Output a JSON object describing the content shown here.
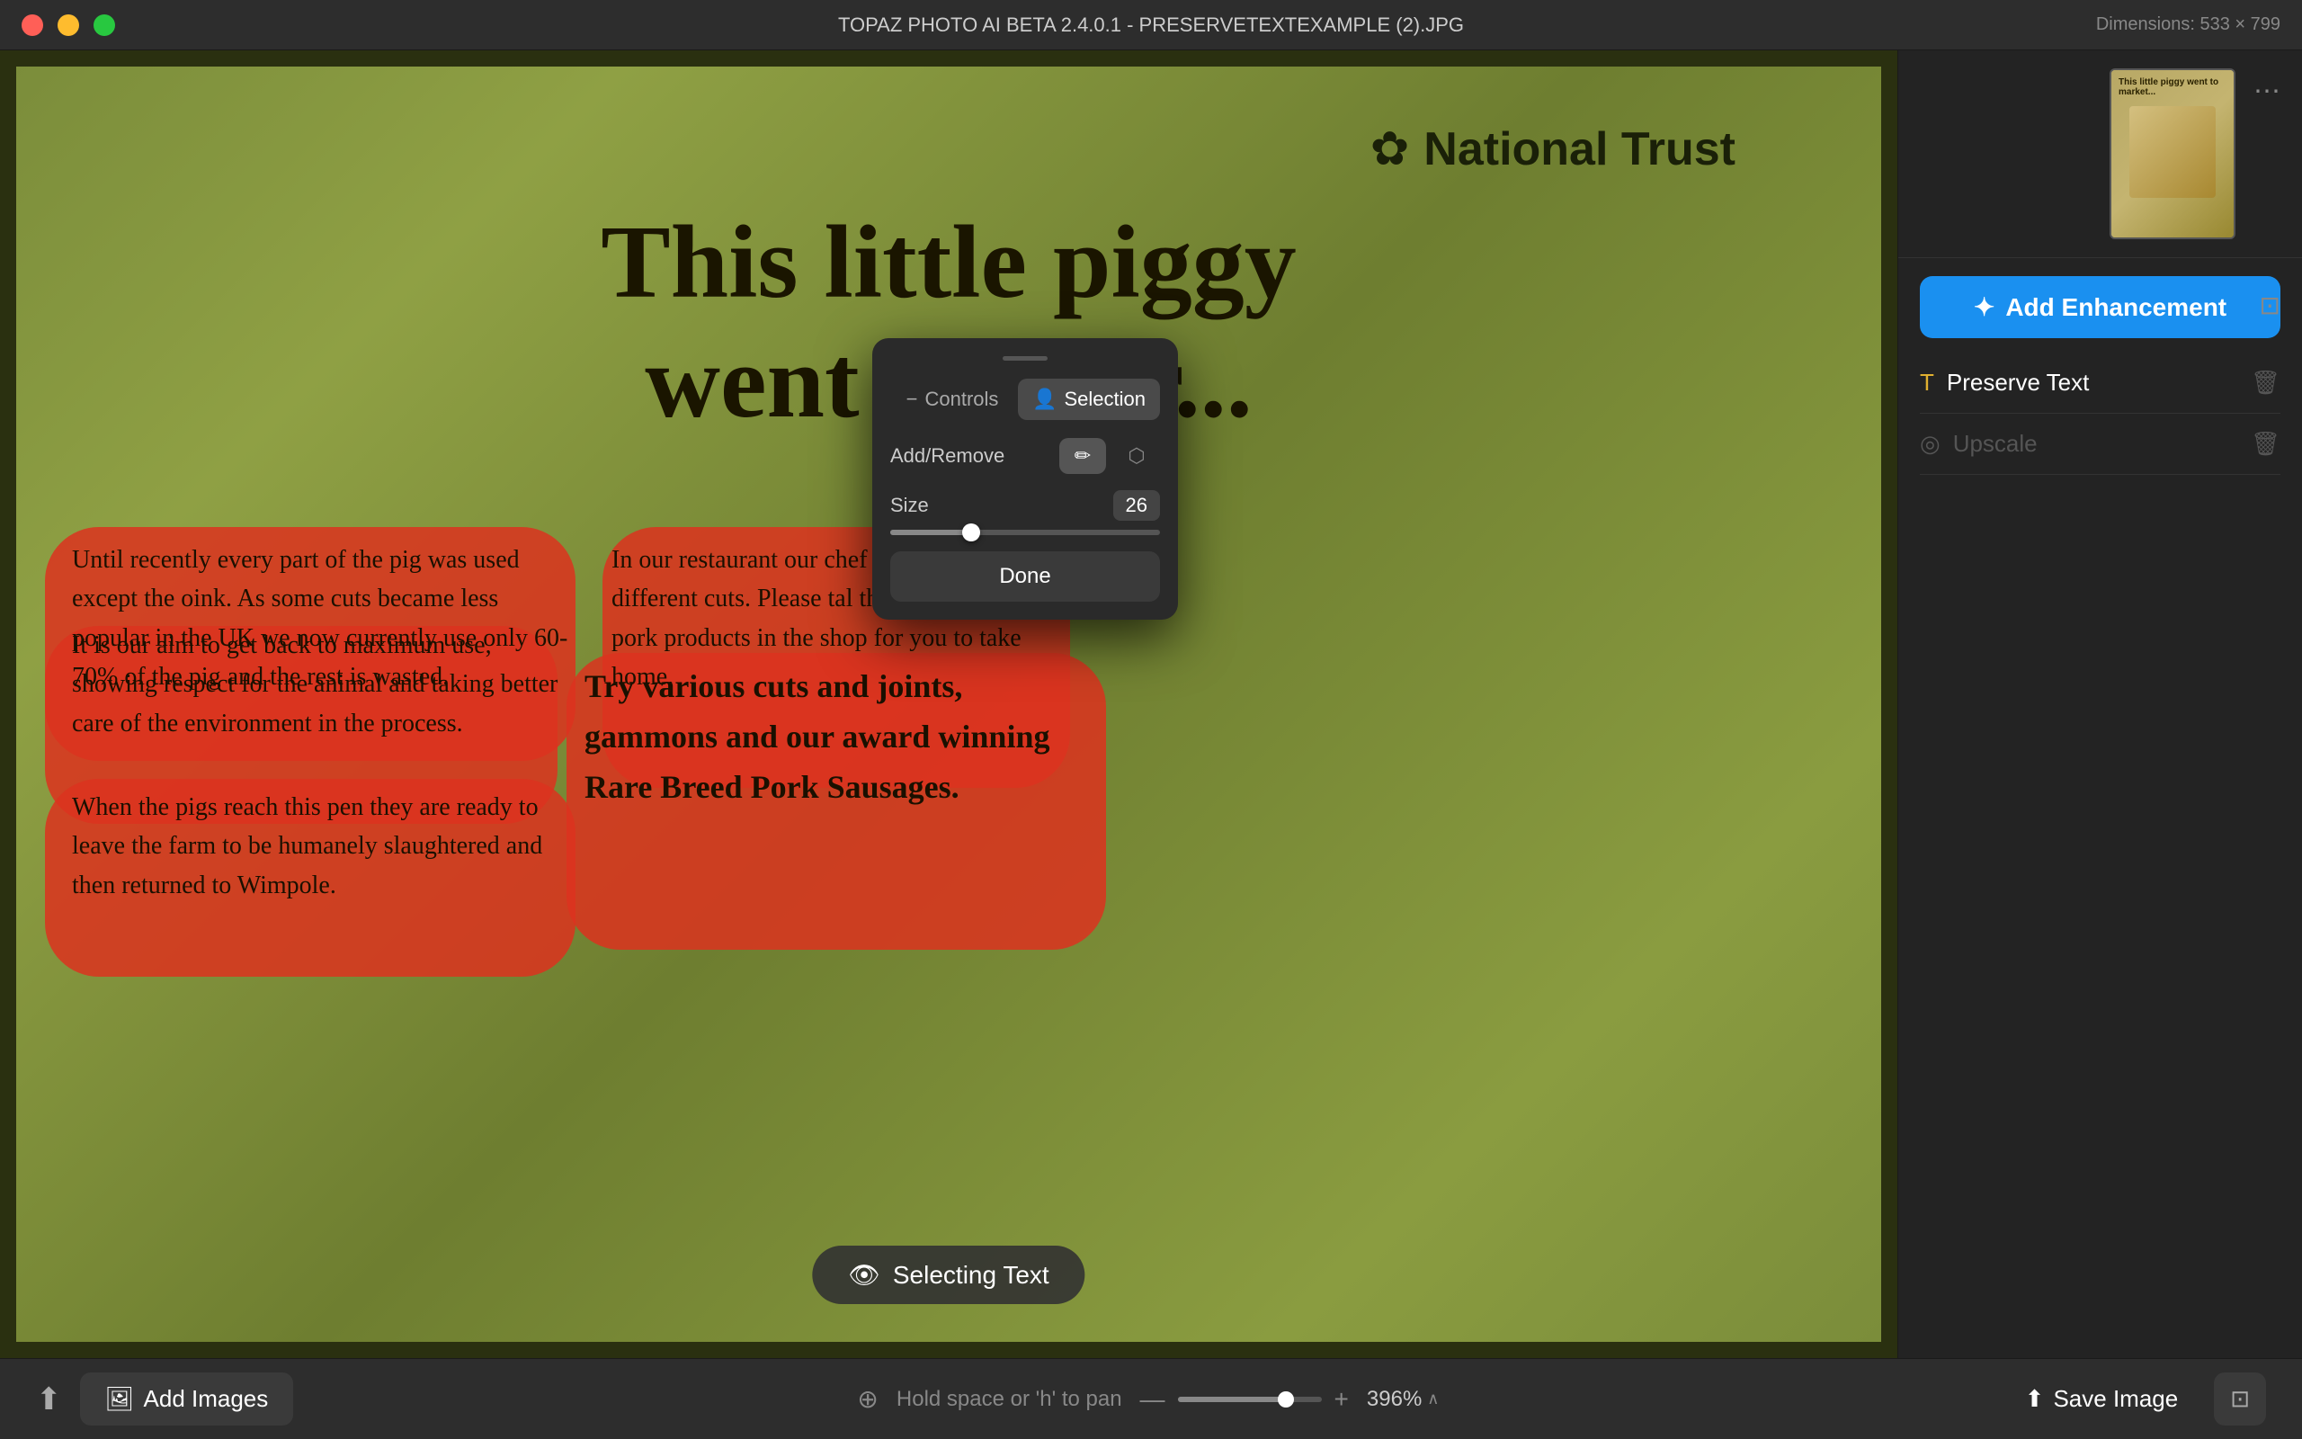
{
  "titlebar": {
    "title": "TOPAZ PHOTO AI BETA 2.4.0.1 - PRESERVETEXTEXAMPLE (2).JPG",
    "dimensions": "Dimensions: 533 × 799"
  },
  "sign": {
    "national_trust": "National Trust",
    "heading_line1": "This little piggy",
    "heading_line2": "went to mar...",
    "text_block1": "Until recently every part of the pig was used except the oink. As some cuts became less popular in the UK we now currently use only 60-70% of the pig and the rest is wasted.",
    "text_block2": "It is our aim to get back to maximum use, showing respect for the animal and taking better care of the environment in the process.",
    "text_block3": "When the pigs reach this pen they are ready to leave the farm to be humanely slaughtered and then returned to Wimpole.",
    "text_block4": "In our restaurant our chef will these different cuts. Please tal the recipes. Our pork products in the shop for you to take home.",
    "text_block5": "Try various cuts and joints, gammons and our award winning Rare Breed Pork Sausages."
  },
  "selection_popup": {
    "drag_handle": "",
    "tab_controls": "Controls",
    "tab_selection": "Selection",
    "add_remove_label": "Add/Remove",
    "btn_add_icon": "✏️",
    "btn_remove_icon": "⬡",
    "size_label": "Size",
    "size_value": "26",
    "slider_percent": 30,
    "done_label": "Done"
  },
  "selecting_badge": {
    "label": "Selecting Text",
    "icon": "👁"
  },
  "right_panel": {
    "add_enhancement_label": "Add Enhancement",
    "add_enhancement_icon": "✦",
    "crop_icon": "⊡",
    "preserve_text_label": "Preserve Text",
    "preserve_text_icon": "T",
    "upscale_label": "Upscale",
    "upscale_icon": "◎",
    "more_options_icon": "⋯",
    "thumbnail_alt": "thumbnail"
  },
  "bottom_bar": {
    "upload_icon": "↑",
    "add_images_label": "Add Images",
    "add_images_icon": "🖼",
    "pan_hint": "Hold space or 'h' to pan",
    "pan_icon": "⊕",
    "zoom_percent": "396%",
    "zoom_arrow": "∧",
    "zoom_minus": "—",
    "zoom_plus": "+",
    "save_image_label": "Save Image",
    "save_icon": "↑",
    "export_icon": "⊡",
    "slider_percent": 75
  }
}
